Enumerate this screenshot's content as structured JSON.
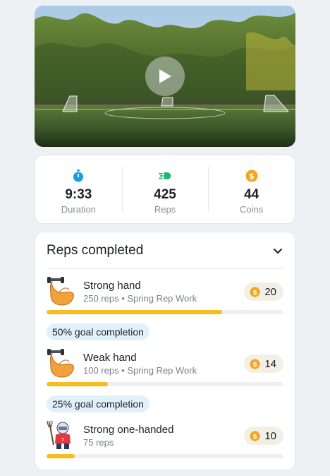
{
  "video": {
    "play_icon": "play-icon"
  },
  "stats": [
    {
      "icon": "stopwatch-icon",
      "color": "#1b9be0",
      "value": "9:33",
      "label": "Duration"
    },
    {
      "icon": "speed-icon",
      "color": "#1db86a",
      "value": "425",
      "label": "Reps"
    },
    {
      "icon": "coin-icon",
      "color": "#f4a51c",
      "value": "44",
      "label": "Coins"
    }
  ],
  "reps": {
    "title": "Reps completed",
    "items": [
      {
        "name": "Strong hand",
        "sub": "250 reps • Spring Rep Work",
        "coins": "20",
        "progress": 0.74,
        "avatar": "flexed-arm-dumbbell-icon"
      },
      {
        "goal": "50% goal completion",
        "name": "Weak hand",
        "sub": "100 reps • Spring Rep Work",
        "coins": "14",
        "progress": 0.26,
        "avatar": "flexed-arm-dumbbell-icon"
      },
      {
        "goal": "25% goal completion",
        "name": "Strong one-handed",
        "sub": "75 reps",
        "coins": "10",
        "progress": 0.12,
        "avatar": "lacrosse-player-icon"
      }
    ]
  },
  "colors": {
    "accent": "#f7bd1e",
    "goal_bg": "#e1f1fb",
    "coin": "#f4a51c"
  }
}
